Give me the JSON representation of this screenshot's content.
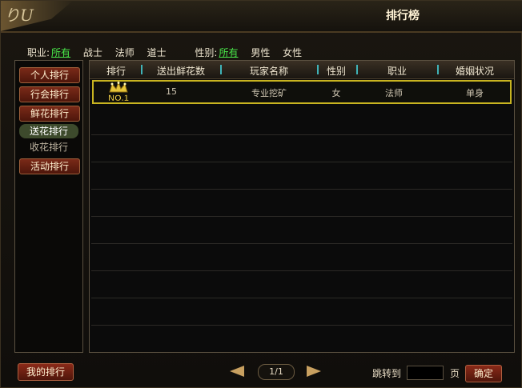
{
  "window": {
    "title": "排行榜",
    "corner_glyph": "りU"
  },
  "filters": {
    "job_label": "职业:",
    "job_options": [
      "所有",
      "战士",
      "法师",
      "道士"
    ],
    "job_selected": "所有",
    "gender_label": "性别:",
    "gender_options": [
      "所有",
      "男性",
      "女性"
    ],
    "gender_selected": "所有"
  },
  "sidebar": {
    "items": [
      {
        "label": "个人排行"
      },
      {
        "label": "行会排行"
      },
      {
        "label": "鲜花排行"
      },
      {
        "label": "送花排行"
      },
      {
        "label": "收花排行"
      },
      {
        "label": "活动排行"
      }
    ],
    "selected": "送花排行"
  },
  "table": {
    "columns": [
      "排行",
      "送出鲜花数",
      "玩家名称",
      "性别",
      "职业",
      "婚姻状况"
    ],
    "rows": [
      {
        "rank": "NO.1",
        "flowers": "15",
        "name": "专业挖矿",
        "gender": "女",
        "job": "法师",
        "marriage": "单身"
      }
    ]
  },
  "footer": {
    "my_rank_label": "我的排行",
    "page": "1/1",
    "jump_label": "跳转到",
    "page_unit": "页",
    "confirm_label": "确定",
    "jump_value": ""
  },
  "colors": {
    "accent_green": "#49e84a",
    "highlight_gold": "#c8b420",
    "button_red": "#7a2a18"
  },
  "icons": [
    "crown-icon",
    "prev-page-icon",
    "next-page-icon"
  ]
}
